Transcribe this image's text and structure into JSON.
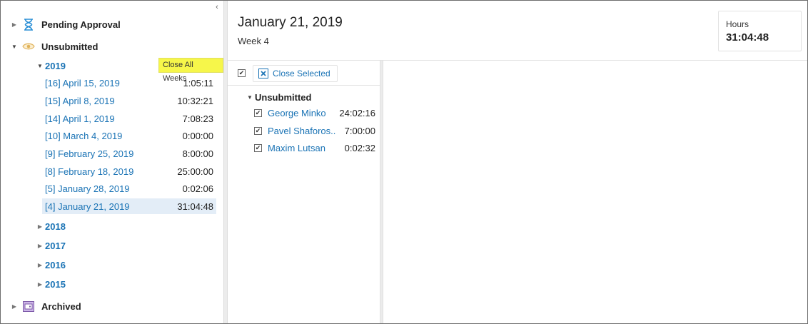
{
  "tree": {
    "pending": {
      "label": "Pending Approval"
    },
    "unsubmitted": {
      "label": "Unsubmitted"
    },
    "archived": {
      "label": "Archived"
    },
    "close_all_label": "Close All Weeks",
    "years": [
      {
        "label": "2019",
        "expanded": true
      },
      {
        "label": "2018",
        "expanded": false
      },
      {
        "label": "2017",
        "expanded": false
      },
      {
        "label": "2016",
        "expanded": false
      },
      {
        "label": "2015",
        "expanded": false
      }
    ],
    "weeks": [
      {
        "label": "[16] April 15, 2019",
        "hours": "1:05:11"
      },
      {
        "label": "[15] April 8, 2019",
        "hours": "10:32:21"
      },
      {
        "label": "[14] April 1, 2019",
        "hours": "7:08:23"
      },
      {
        "label": "[10] March 4, 2019",
        "hours": "0:00:00"
      },
      {
        "label": "[9] February 25, 2019",
        "hours": "8:00:00"
      },
      {
        "label": "[8] February 18, 2019",
        "hours": "25:00:00"
      },
      {
        "label": "[5] January 28, 2019",
        "hours": "0:02:06"
      },
      {
        "label": "[4] January 21, 2019",
        "hours": "31:04:48",
        "selected": true
      }
    ]
  },
  "header": {
    "date": "January 21, 2019",
    "week": "Week 4",
    "hours_label": "Hours",
    "hours_value": "31:04:48"
  },
  "users_pane": {
    "close_selected_label": "Close Selected",
    "group_label": "Unsubmitted",
    "users": [
      {
        "name": "George Minko",
        "hours": "24:02:16"
      },
      {
        "name": "Pavel Shaforos...",
        "hours": "7:00:00"
      },
      {
        "name": "Maxim Lutsan",
        "hours": "0:02:32"
      }
    ]
  },
  "icons": {
    "collapse": "chevron-left-icon",
    "pending": "hourglass-icon",
    "unsubmitted": "eye-icon",
    "archived": "archive-icon",
    "close_selected": "close-x-icon"
  },
  "colors": {
    "link": "#1a73b5",
    "highlight": "#f6f64a",
    "selected_row": "#e3edf7"
  }
}
